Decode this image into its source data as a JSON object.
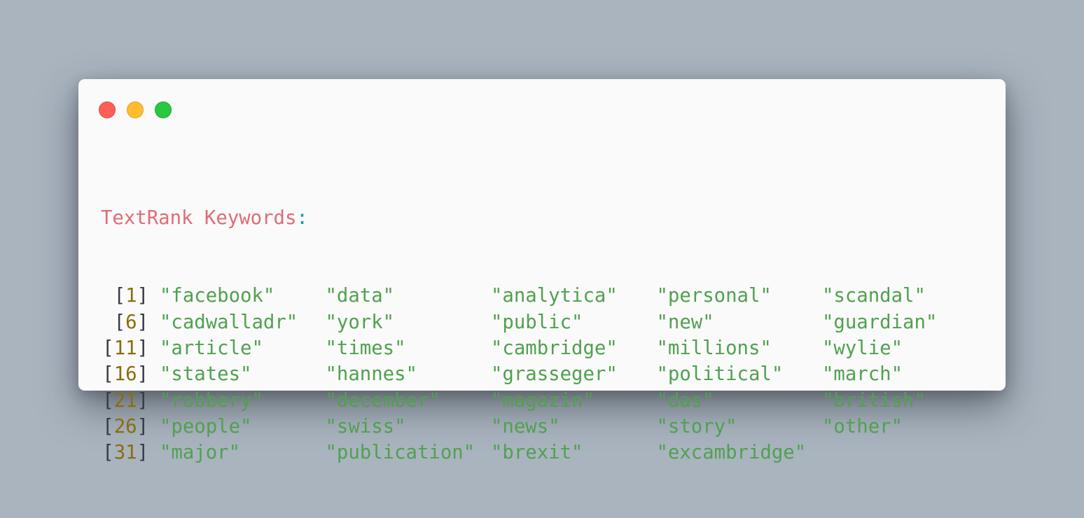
{
  "window": {
    "controls": [
      {
        "name": "close",
        "color": "#ff5f57",
        "border": "#e0443e"
      },
      {
        "name": "minimize",
        "color": "#febc2e",
        "border": "#dea123"
      },
      {
        "name": "zoom",
        "color": "#28c840",
        "border": "#1aab29"
      }
    ]
  },
  "output": {
    "title": "TextRank Keywords",
    "title_colon": ":",
    "rows": [
      {
        "index": "1",
        "keywords": [
          "\"facebook\"",
          "\"data\"",
          "\"analytica\"",
          "\"personal\"",
          "\"scandal\""
        ]
      },
      {
        "index": "6",
        "keywords": [
          "\"cadwalladr\"",
          "\"york\"",
          "\"public\"",
          "\"new\"",
          "\"guardian\""
        ]
      },
      {
        "index": "11",
        "keywords": [
          "\"article\"",
          "\"times\"",
          "\"cambridge\"",
          "\"millions\"",
          "\"wylie\""
        ]
      },
      {
        "index": "16",
        "keywords": [
          "\"states\"",
          "\"hannes\"",
          "\"grasseger\"",
          "\"political\"",
          "\"march\""
        ]
      },
      {
        "index": "21",
        "keywords": [
          "\"robbery\"",
          "\"december\"",
          "\"magazin\"",
          "\"das\"",
          "\"british\""
        ]
      },
      {
        "index": "26",
        "keywords": [
          "\"people\"",
          "\"swiss\"",
          "\"news\"",
          "\"story\"",
          "\"other\""
        ]
      },
      {
        "index": "31",
        "keywords": [
          "\"major\"",
          "\"publication\"",
          "\"brexit\"",
          "\"excambridge\""
        ]
      }
    ]
  },
  "colors": {
    "background": "#a9b4bf",
    "window": "#fafafa",
    "title": "#e06c75",
    "colon": "#0e9aa7",
    "keyword": "#50a14f",
    "index_number": "#8a6d0b",
    "bracket": "#383a42"
  }
}
